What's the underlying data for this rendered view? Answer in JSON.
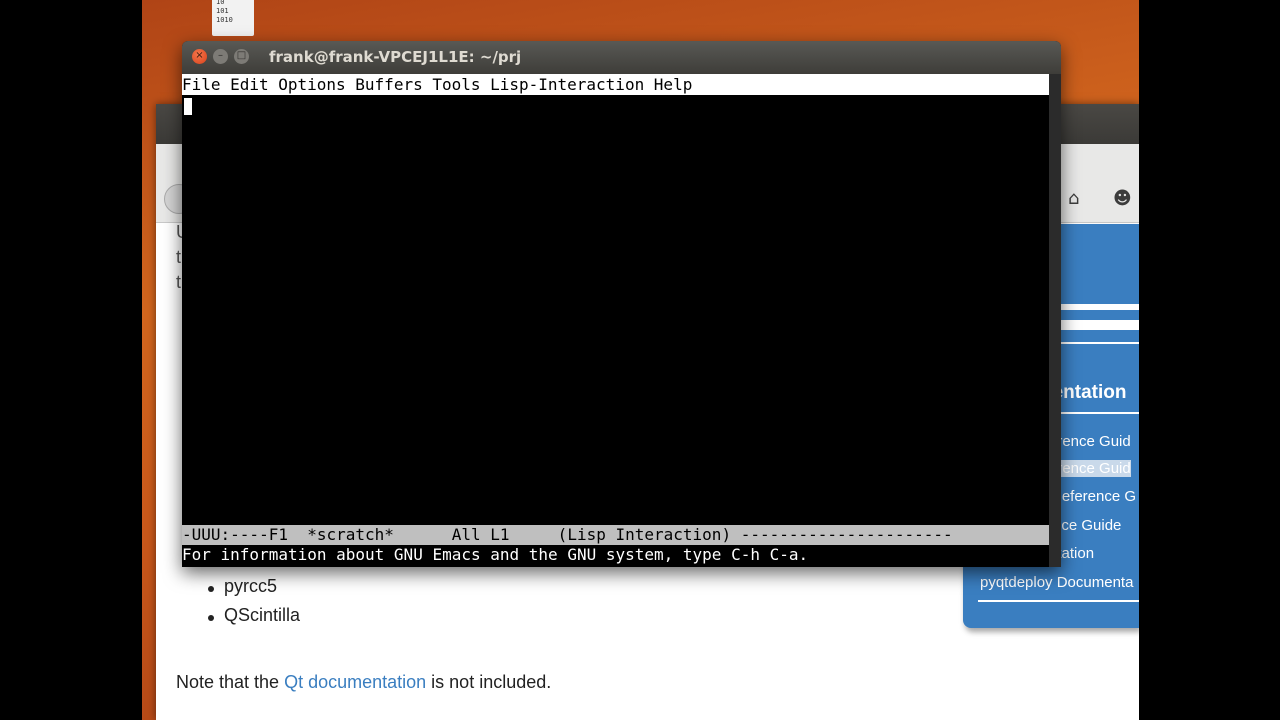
{
  "desktop": {
    "icon_lines": [
      "10",
      "101",
      "1010"
    ]
  },
  "browser": {
    "sidebar": {
      "heading": "nentation",
      "items": [
        {
          "label": "erence Guid"
        },
        {
          "label": "erence Guid"
        },
        {
          "label": "Reference G"
        },
        {
          "label": "nce Guide"
        },
        {
          "label": "ntation"
        },
        {
          "label": "pyqtdeploy Documenta"
        }
      ]
    },
    "left_fragments": [
      "U",
      "t",
      "t"
    ],
    "bullets": [
      "pyrcc5",
      "QScintilla"
    ],
    "note": {
      "prefix": "Note that the ",
      "link": "Qt documentation",
      "suffix": " is not included."
    }
  },
  "terminal": {
    "title": "frank@frank-VPCEJ1L1E: ~/prj",
    "menu": [
      "File",
      "Edit",
      "Options",
      "Buffers",
      "Tools",
      "Lisp-Interaction",
      "Help"
    ],
    "modeline": "-UUU:----F1  *scratch*      All L1     (Lisp Interaction) ----------------------",
    "echo": "For information about GNU Emacs and the GNU system, type C-h C-a."
  }
}
